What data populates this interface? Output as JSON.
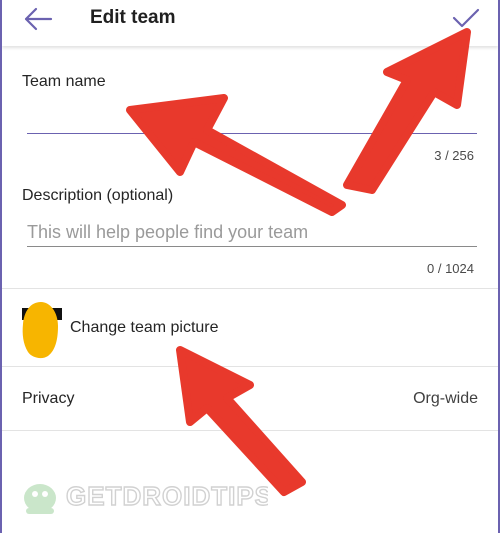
{
  "header": {
    "title": "Edit team",
    "back_icon": "arrow-left-icon",
    "confirm_icon": "checkmark-icon"
  },
  "team_name": {
    "label": "Team name",
    "value": "",
    "counter": "3 / 256"
  },
  "description": {
    "label": "Description (optional)",
    "placeholder": "This will help people find your team",
    "counter": "0 / 1024"
  },
  "team_picture": {
    "label": "Change team picture"
  },
  "privacy": {
    "label": "Privacy",
    "value": "Org-wide"
  },
  "watermark": {
    "text": "GETDROIDTIPS"
  },
  "colors": {
    "accent": "#6b62b0",
    "annotation_red": "#e8392c",
    "avatar_yellow": "#f7b500"
  }
}
